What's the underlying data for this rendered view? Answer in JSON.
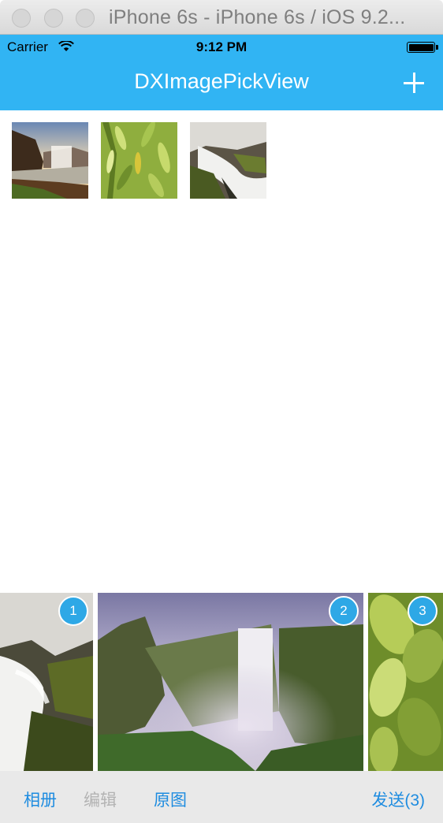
{
  "window": {
    "title": "iPhone 6s - iPhone 6s / iOS 9.2..."
  },
  "status_bar": {
    "carrier": "Carrier",
    "time": "9:12 PM",
    "battery_level": 1.0
  },
  "nav": {
    "title": "DXImagePickView",
    "add_icon": "plus-icon"
  },
  "selected_thumbnails": [
    {
      "name": "waterfall-sunset"
    },
    {
      "name": "bamboo-leaves"
    },
    {
      "name": "stream-rocks"
    }
  ],
  "picker_strip": [
    {
      "badge": "1",
      "name": "stream-rocks"
    },
    {
      "badge": "2",
      "name": "skogafoss-waterfall"
    },
    {
      "badge": "3",
      "name": "green-leaves"
    }
  ],
  "toolbar": {
    "album": "相册",
    "edit": "编辑",
    "original": "原图",
    "send": "发送(3)"
  },
  "colors": {
    "accent": "#31b4f3",
    "link": "#1e8ce0",
    "disabled": "#b3b3b3",
    "badge": "#2ea8e6"
  }
}
